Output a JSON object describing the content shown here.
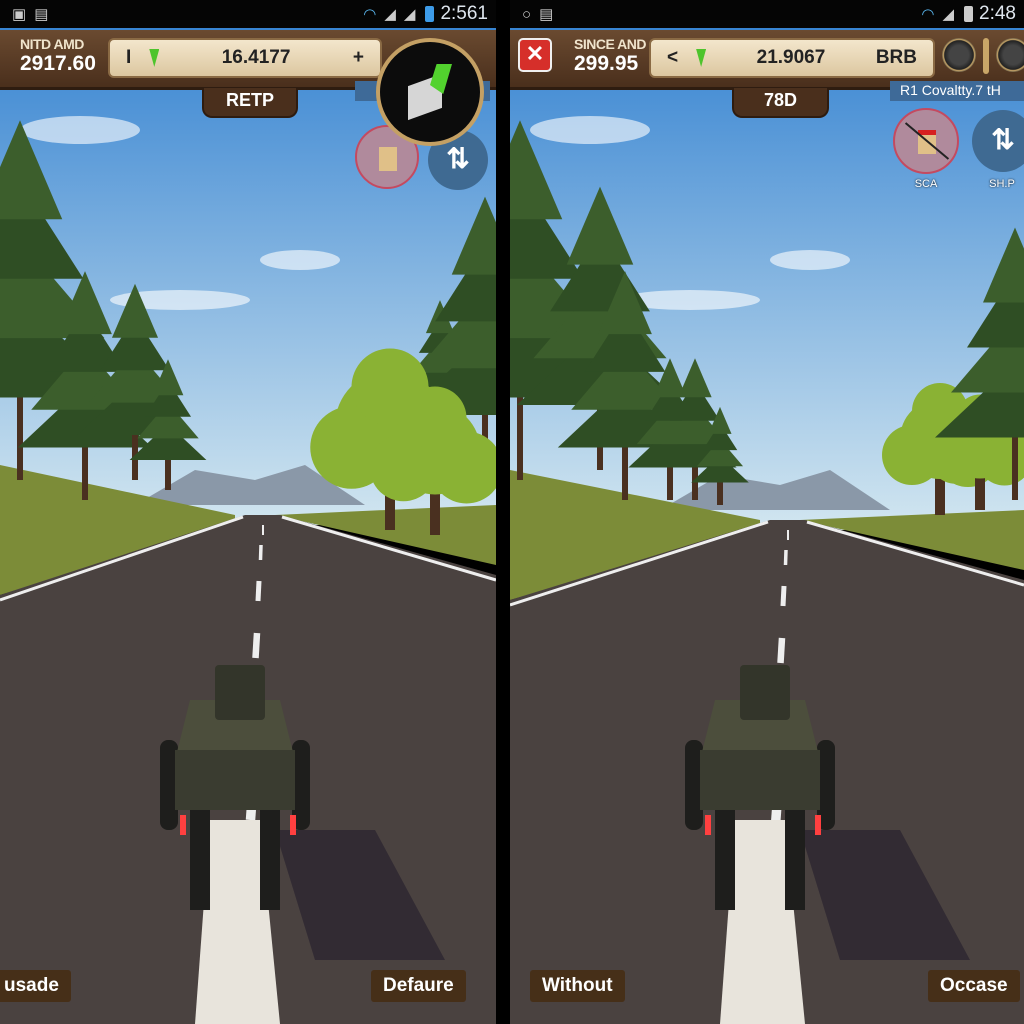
{
  "left": {
    "status": {
      "time": "2:561"
    },
    "hud": {
      "stat_label": "NITD AMD",
      "stat_value": "2917.60",
      "bar_left": "I",
      "bar_value": "16.4177",
      "bar_right": "+",
      "tab": "RETP"
    },
    "icons": [
      "wifi-icon",
      "signal-icon",
      "battery-icon",
      "block-item-icon",
      "no-item-icon",
      "swap-icon"
    ],
    "bottom": {
      "left": "usade",
      "right": "Defaure"
    }
  },
  "right": {
    "status": {
      "time": "2:48"
    },
    "hud": {
      "stat_label": "SINCE AND",
      "stat_value": "299.95",
      "bar_left": "<",
      "bar_value": "21.9067",
      "bar_right": "BRB",
      "tab": "78D"
    },
    "info": "R1 Covaltty.7 tH",
    "buttons": [
      {
        "label": "SCA",
        "icon": "no-item-icon"
      },
      {
        "label": "SH.P",
        "icon": "swap-icon"
      }
    ],
    "bottom": {
      "left": "Without",
      "right": "Occase"
    }
  },
  "colors": {
    "hud": "#5a3c24",
    "close": "#d62f2a",
    "sky": "#3f8fd8",
    "road": "#4a4240"
  }
}
